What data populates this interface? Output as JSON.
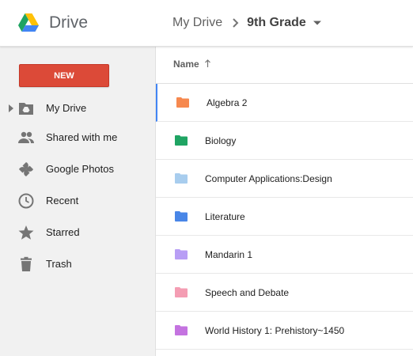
{
  "header": {
    "app_name": "Drive",
    "breadcrumb_root": "My Drive",
    "breadcrumb_current": "9th Grade"
  },
  "sidebar": {
    "new_button": "NEW",
    "items": [
      {
        "label": "My Drive",
        "icon": "drive-folder-icon"
      },
      {
        "label": "Shared with me",
        "icon": "people-icon"
      },
      {
        "label": "Google Photos",
        "icon": "photos-pinwheel-icon"
      },
      {
        "label": "Recent",
        "icon": "clock-icon"
      },
      {
        "label": "Starred",
        "icon": "star-icon"
      },
      {
        "label": "Trash",
        "icon": "trash-icon"
      }
    ]
  },
  "list": {
    "column_name": "Name",
    "sort": "ascending",
    "folders": [
      {
        "name": "Algebra 2",
        "color": "#f6894f",
        "selected": true
      },
      {
        "name": "Biology",
        "color": "#1fa463"
      },
      {
        "name": "Computer Applications:Design",
        "color": "#a8cdee"
      },
      {
        "name": "Literature",
        "color": "#4986e7"
      },
      {
        "name": "Mandarin 1",
        "color": "#b89ef5"
      },
      {
        "name": "Speech and Debate",
        "color": "#f49db3"
      },
      {
        "name": "World History 1: Prehistory~1450",
        "color": "#c473e0"
      }
    ]
  },
  "colors": {
    "new_button": "#dc4a38",
    "selection_accent": "#4285f4",
    "sidebar_bg": "#f1f1f1"
  }
}
